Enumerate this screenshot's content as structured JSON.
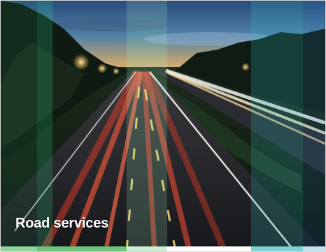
{
  "card": {
    "title": "Road services"
  },
  "image": {
    "subject": "motorway-night-light-trails"
  },
  "colors": {
    "title_text": "#ffffff",
    "tint_green": "#2fd28a",
    "tint_mint": "#a6f2c8",
    "tint_teal": "#33bfc0",
    "tint_blue": "#2b8fd6",
    "strip_green": "#8fd49a",
    "strip_mint": "#c9f0d3",
    "strip_teal": "#7fd1d6",
    "strip_blue": "#c3e2f0"
  }
}
